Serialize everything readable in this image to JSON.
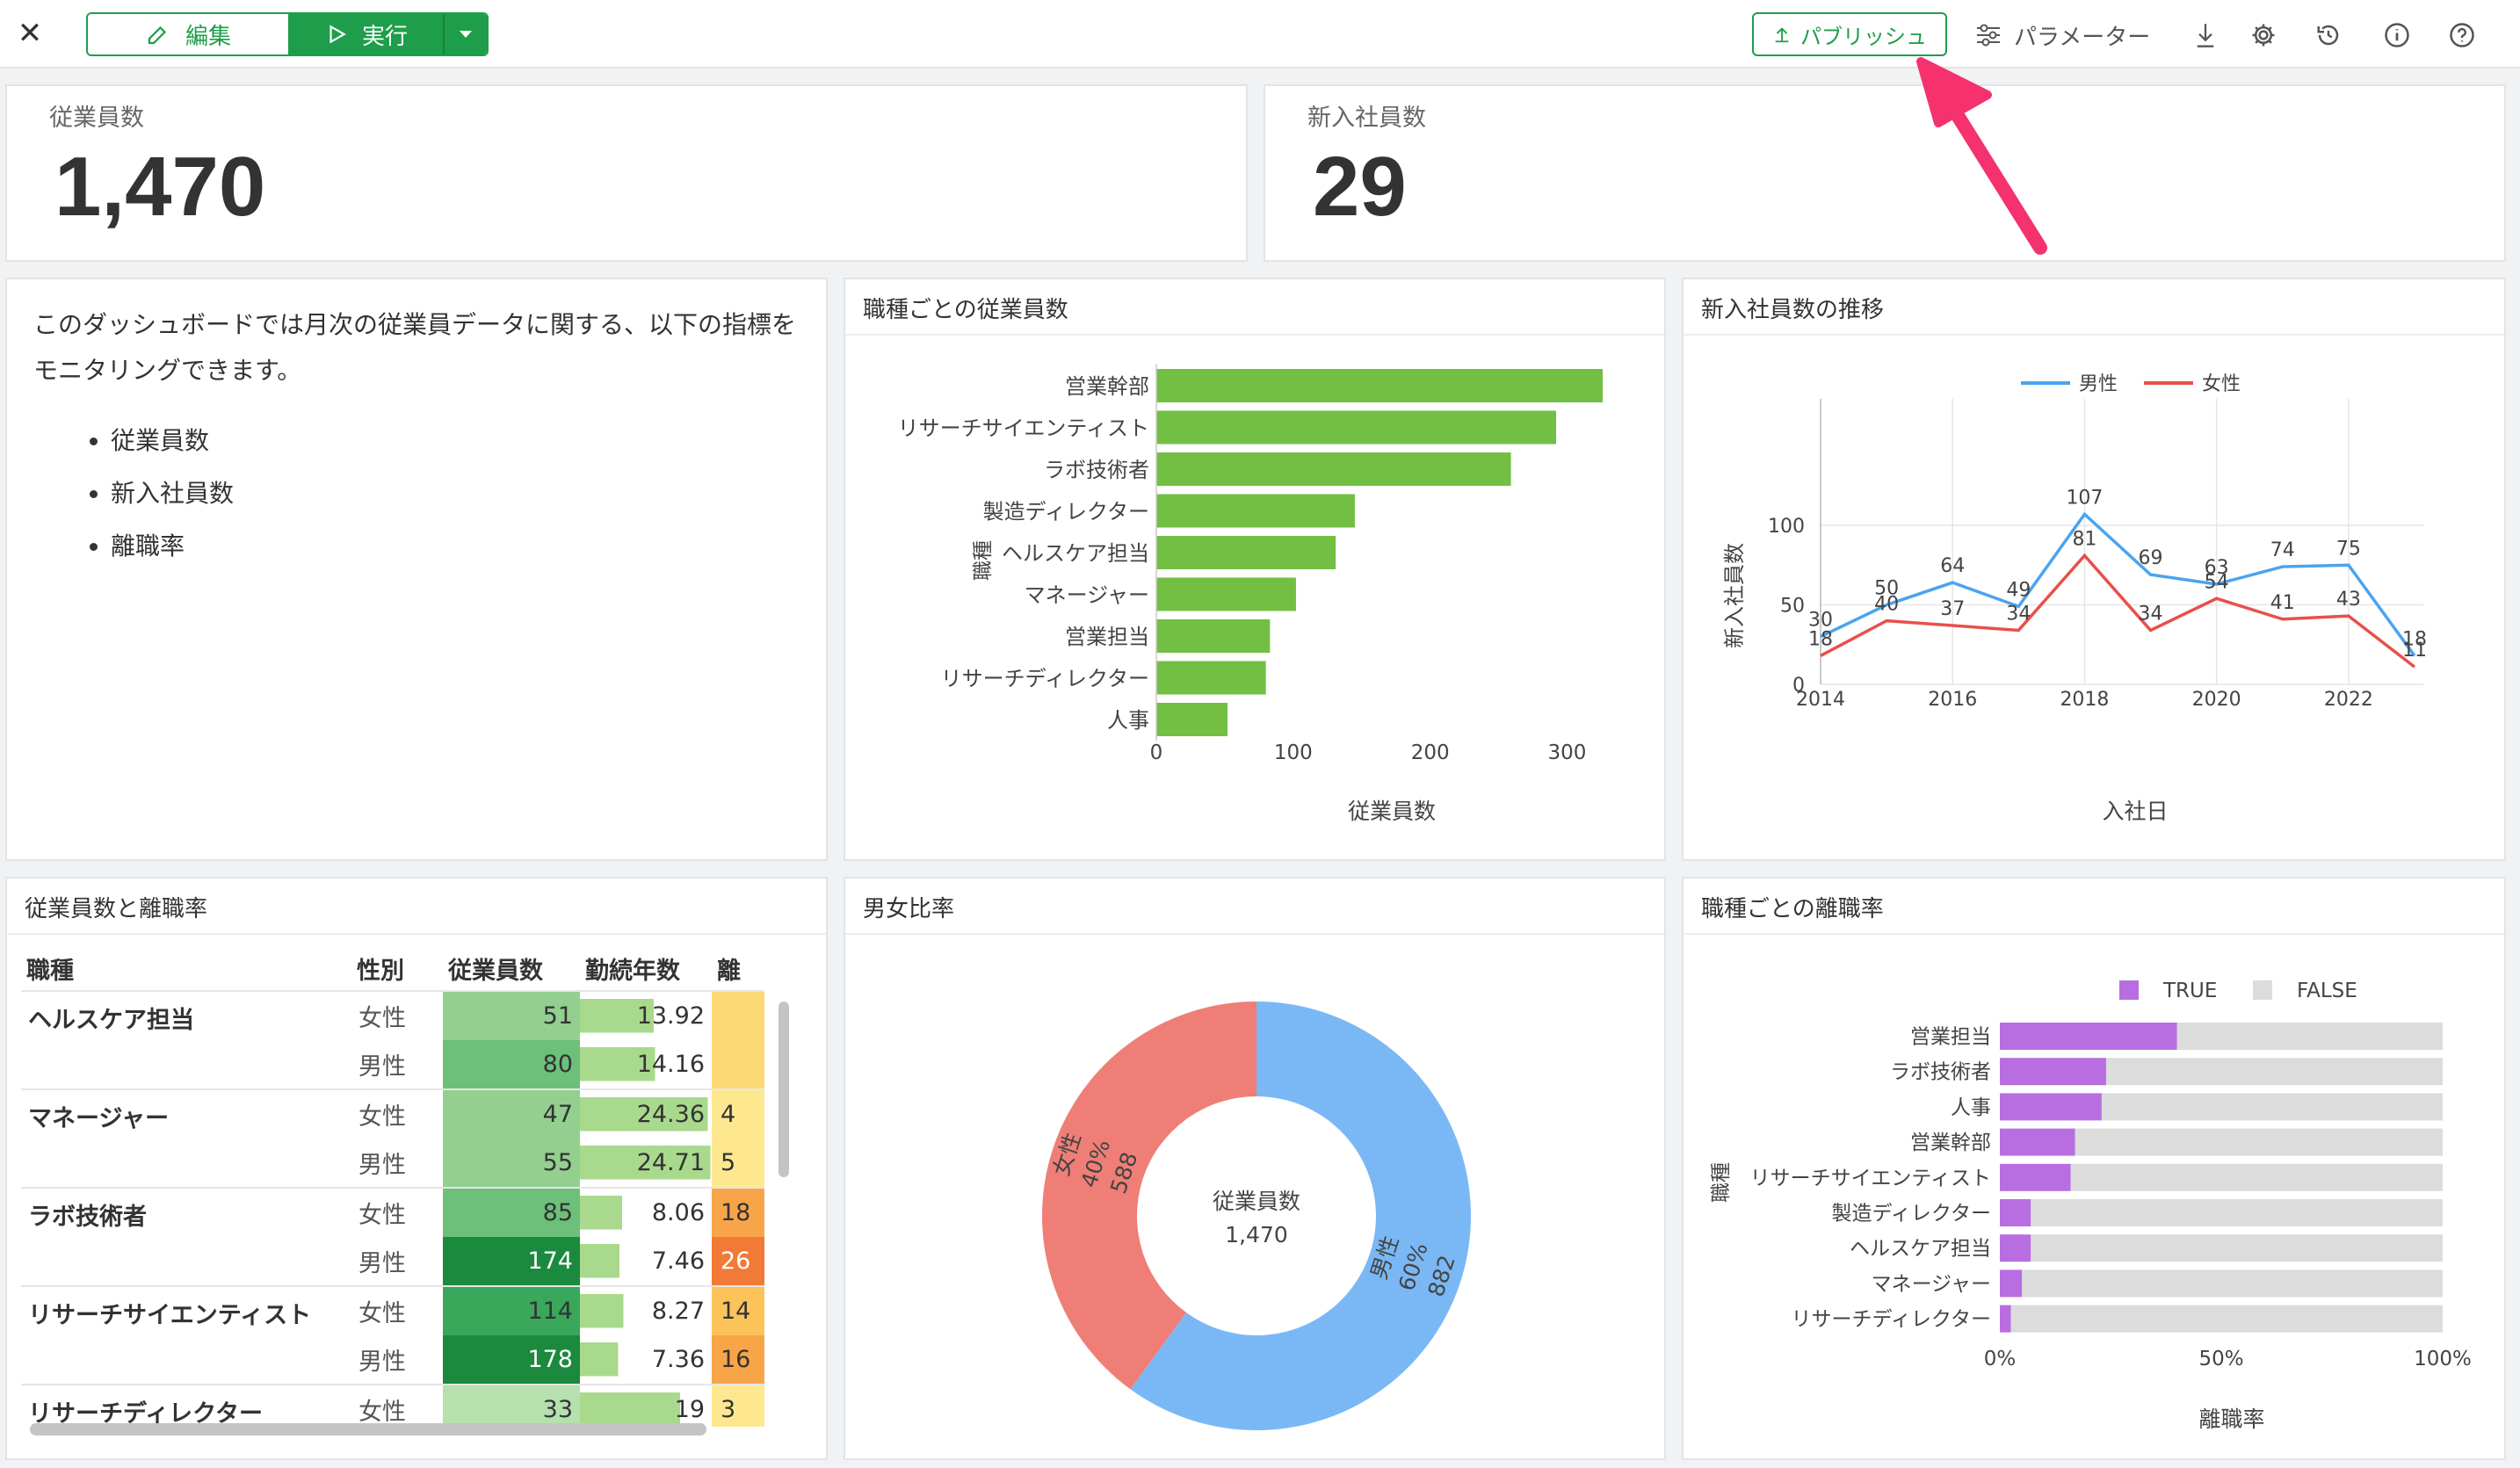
{
  "toolbar": {
    "edit_label": "編集",
    "run_label": "実行",
    "publish_label": "パブリッシュ",
    "parameter_label": "パラメーター",
    "accent_color": "#1e9e4a"
  },
  "kpis": [
    {
      "label": "従業員数",
      "value": "1,470"
    },
    {
      "label": "新入社員数",
      "value": "29"
    }
  ],
  "description": {
    "text": "このダッシュボードでは月次の従業員データに関する、以下の指標をモニタリングできます。",
    "items": [
      "従業員数",
      "新入社員数",
      "離職率"
    ]
  },
  "bar_card": {
    "title": "職種ごとの従業員数"
  },
  "line_card": {
    "title": "新入社員数の推移"
  },
  "table_card": {
    "title": "従業員数と離職率"
  },
  "donut_card": {
    "title": "男女比率"
  },
  "stack_card": {
    "title": "職種ごとの離職率"
  },
  "table": {
    "headers": [
      "職種",
      "性別",
      "従業員数",
      "勤続年数",
      "離"
    ],
    "rows": [
      {
        "role": "ヘルスケア担当",
        "gender": "女性",
        "count": "51",
        "tenure": "13.92",
        "rate": ""
      },
      {
        "role": "",
        "gender": "男性",
        "count": "80",
        "tenure": "14.16",
        "rate": ""
      },
      {
        "role": "マネージャー",
        "gender": "女性",
        "count": "47",
        "tenure": "24.36",
        "rate": "4"
      },
      {
        "role": "",
        "gender": "男性",
        "count": "55",
        "tenure": "24.71",
        "rate": "5"
      },
      {
        "role": "ラボ技術者",
        "gender": "女性",
        "count": "85",
        "tenure": "8.06",
        "rate": "18"
      },
      {
        "role": "",
        "gender": "男性",
        "count": "174",
        "tenure": "7.46",
        "rate": "26"
      },
      {
        "role": "リサーチサイエンティスト",
        "gender": "女性",
        "count": "114",
        "tenure": "8.27",
        "rate": "14"
      },
      {
        "role": "",
        "gender": "男性",
        "count": "178",
        "tenure": "7.36",
        "rate": "16"
      },
      {
        "role": "リサーチディレクター",
        "gender": "女性",
        "count": "33",
        "tenure": "19",
        "rate": "3"
      }
    ]
  },
  "chart_data": [
    {
      "type": "bar",
      "orientation": "horizontal",
      "categories": [
        "営業幹部",
        "リサーチサイエンティスト",
        "ラボ技術者",
        "製造ディレクター",
        "ヘルスケア担当",
        "マネージャー",
        "営業担当",
        "リサーチディレクター",
        "人事"
      ],
      "values": [
        326,
        292,
        259,
        145,
        131,
        102,
        83,
        80,
        52
      ],
      "xlabel": "従業員数",
      "ylabel": "職種",
      "xlim": [
        0,
        326
      ],
      "xticks": [
        "0",
        "100",
        "200",
        "300"
      ],
      "color": "#72bf44"
    },
    {
      "type": "line",
      "x": [
        2014,
        2015,
        2016,
        2017,
        2018,
        2019,
        2020,
        2021,
        2022,
        2023
      ],
      "series": [
        {
          "name": "男性",
          "values": [
            30,
            50,
            64,
            49,
            107,
            69,
            63,
            74,
            75,
            18
          ],
          "color": "#4aa3f0"
        },
        {
          "name": "女性",
          "values": [
            18,
            40,
            37,
            34,
            81,
            34,
            54,
            41,
            43,
            11
          ],
          "color": "#e8504a"
        }
      ],
      "xlabel": "入社日",
      "ylabel": "新入社員数",
      "xticks": [
        "2014",
        "2016",
        "2018",
        "2020",
        "2022"
      ],
      "yticks": [
        "0",
        "50",
        "100"
      ],
      "ylim": [
        0,
        107
      ],
      "grid": true,
      "legend": "top"
    },
    {
      "type": "pie",
      "donut": true,
      "center_label": "従業員数",
      "center_value": "1,470",
      "slices": [
        {
          "name": "男性",
          "value": 882,
          "percent": "60%",
          "color": "#7ab8f5"
        },
        {
          "name": "女性",
          "value": 588,
          "percent": "40%",
          "color": "#ef7f76"
        }
      ]
    },
    {
      "type": "bar",
      "orientation": "horizontal",
      "stacked": true,
      "categories": [
        "営業担当",
        "ラボ技術者",
        "人事",
        "営業幹部",
        "リサーチサイエンティスト",
        "製造ディレクター",
        "ヘルスケア担当",
        "マネージャー",
        "リサーチディレクター"
      ],
      "series": [
        {
          "name": "TRUE",
          "values": [
            0.4,
            0.24,
            0.23,
            0.17,
            0.16,
            0.07,
            0.07,
            0.05,
            0.025
          ],
          "color": "#b86ee0"
        },
        {
          "name": "FALSE",
          "values": [
            0.6,
            0.76,
            0.77,
            0.83,
            0.84,
            0.93,
            0.93,
            0.95,
            0.975
          ],
          "color": "#dcdcdc"
        }
      ],
      "xlabel": "離職率",
      "ylabel": "職種",
      "xticks": [
        "0%",
        "50%",
        "100%"
      ],
      "legend": "top"
    }
  ]
}
